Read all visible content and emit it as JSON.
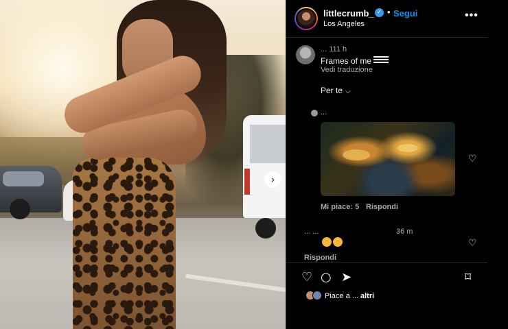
{
  "post": {
    "username": "littlecrumb_",
    "follow_label": "Segui",
    "location": "Los Angeles",
    "more_icon": "•••",
    "verified_icon": "✓"
  },
  "caption": {
    "user_time": "... 111 h",
    "text": "Frames of me",
    "translate_label": "Vedi traduzione"
  },
  "filter": {
    "label": "Per te",
    "chevron": "⌵"
  },
  "comments": [
    {
      "user": "...",
      "likes_label": "Mi piace: 5",
      "reply_label": "Rispondi"
    },
    {
      "user": "... ...",
      "time": "36 m",
      "reply_label": "Rispondi"
    }
  ],
  "liked_by": {
    "prefix": "Piace a",
    "suffix": "altri"
  },
  "nav": {
    "next_arrow": "›"
  },
  "icons": {
    "heart": "♡",
    "comment": "○",
    "share": "➤",
    "bookmark": "⌑"
  },
  "colors": {
    "accent": "#0095f6",
    "verified": "#3897f0",
    "background": "#000000"
  }
}
